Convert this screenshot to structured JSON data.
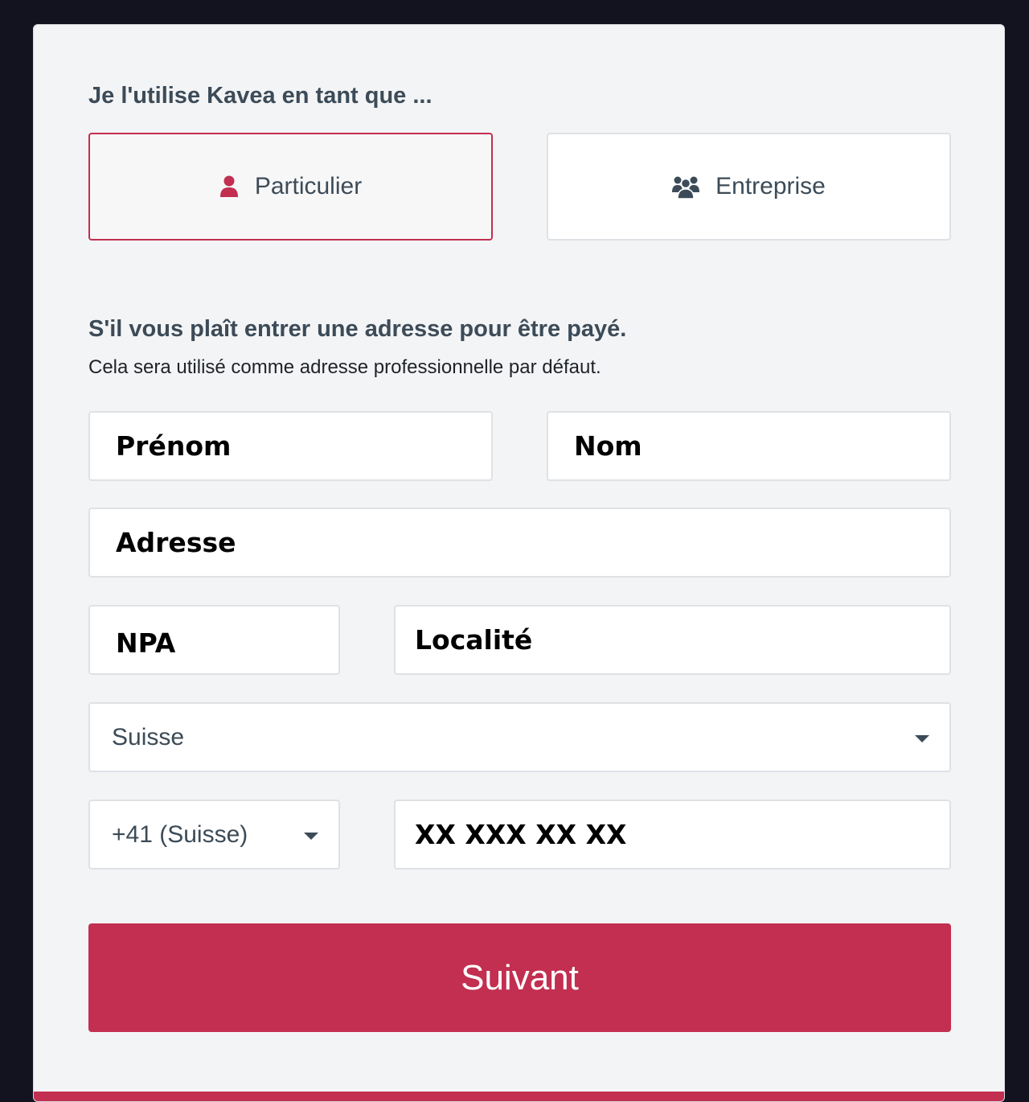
{
  "account_type": {
    "heading": "Je l'utilise Kavea en tant que ...",
    "options": [
      {
        "label": "Particulier",
        "icon": "user-icon",
        "selected": true
      },
      {
        "label": "Entreprise",
        "icon": "users-group-icon",
        "selected": false
      }
    ]
  },
  "address": {
    "heading": "S'il vous plaît entrer une adresse pour être payé.",
    "subtext": "Cela sera utilisé comme adresse professionnelle par défaut.",
    "first_name_placeholder": "Prénom",
    "last_name_placeholder": "Nom",
    "street_placeholder": "Adresse",
    "postal_code_placeholder": "NPA",
    "city_placeholder": "Localité",
    "country_selected": "Suisse",
    "phone_prefix_selected": "+41 (Suisse)",
    "phone_placeholder": "XX XXX XX XX"
  },
  "submit_label": "Suivant",
  "colors": {
    "accent": "#c22f50",
    "text_heading": "#3c4b57",
    "page_background": "#131320",
    "card_background": "#f3f4f6"
  }
}
